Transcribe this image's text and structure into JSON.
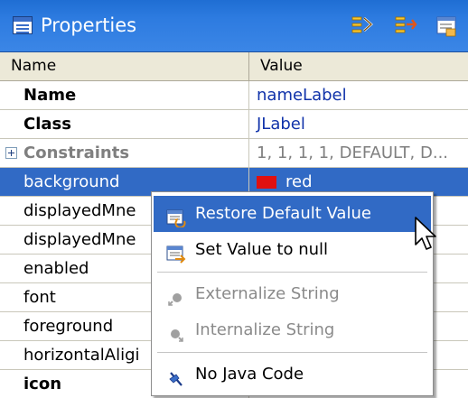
{
  "window": {
    "title": "Properties",
    "title_icon": "properties-table-icon",
    "toolbar": [
      {
        "name": "show-advanced-properties-icon"
      },
      {
        "name": "show-events-icon"
      },
      {
        "name": "goto-definition-icon"
      }
    ]
  },
  "columns": {
    "name": "Name",
    "value": "Value"
  },
  "rows": [
    {
      "name": "Name",
      "value": "nameLabel"
    },
    {
      "name": "Class",
      "value": "JLabel"
    },
    {
      "name": "Constraints",
      "value": "1, 1, 1, 1, DEFAULT, D..."
    },
    {
      "name": "background",
      "value": "red"
    },
    {
      "name": "displayedMne",
      "value": ""
    },
    {
      "name": "displayedMne",
      "value": ""
    },
    {
      "name": "enabled",
      "value": ""
    },
    {
      "name": "font",
      "value": ""
    },
    {
      "name": "foreground",
      "value": ""
    },
    {
      "name": "horizontalAligi",
      "value": ""
    },
    {
      "name": "icon",
      "value": ""
    }
  ],
  "context_menu": {
    "items": [
      {
        "label": "Restore Default Value",
        "icon": "restore-default-icon",
        "state": "highlighted"
      },
      {
        "label": "Set Value to null",
        "icon": "set-null-icon",
        "state": "enabled"
      },
      {
        "label": "Externalize String",
        "icon": "externalize-string-icon",
        "state": "disabled"
      },
      {
        "label": "Internalize String",
        "icon": "internalize-string-icon",
        "state": "disabled"
      },
      {
        "label": "No Java Code",
        "icon": "no-java-code-icon",
        "state": "enabled"
      }
    ]
  },
  "colors": {
    "title_bar": "#2d7be0",
    "selection": "#316ac5",
    "swatch_red": "#e01010",
    "value_link": "#1133aa"
  }
}
